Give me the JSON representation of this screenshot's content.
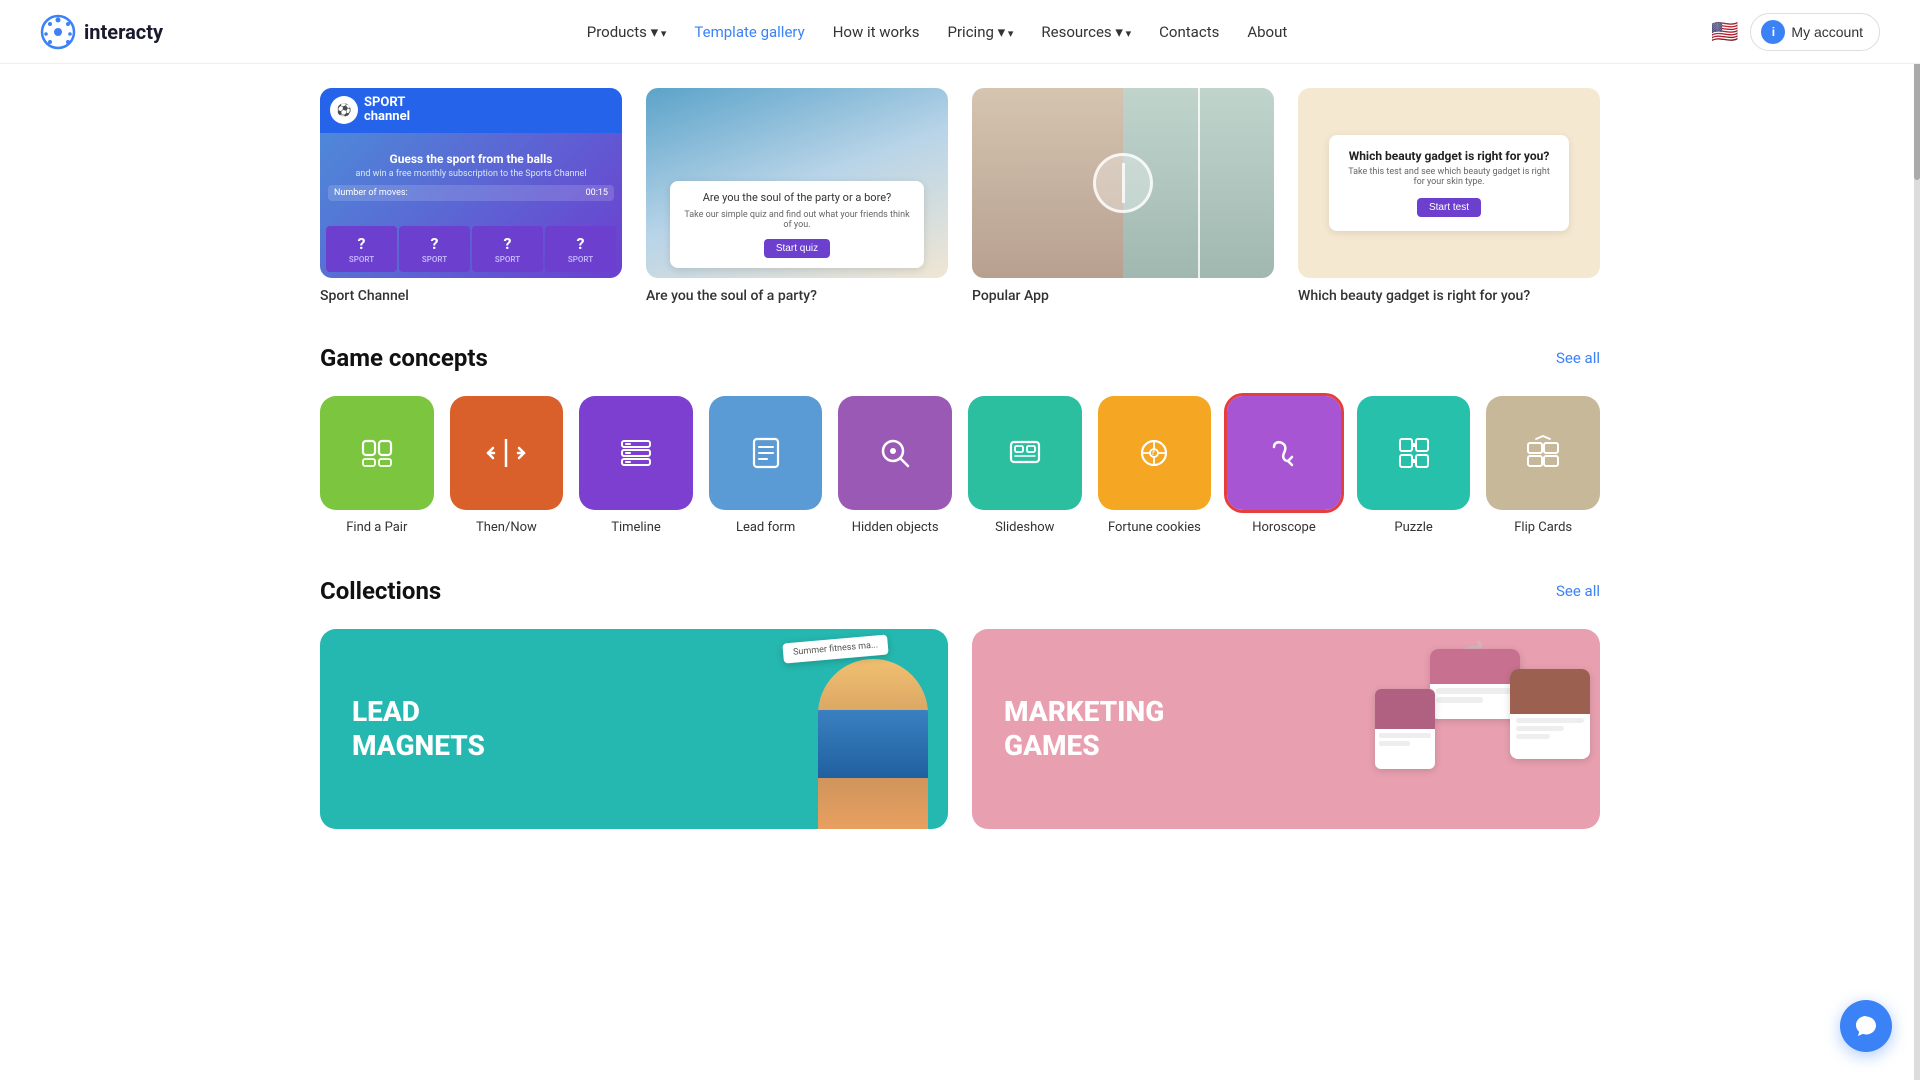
{
  "nav": {
    "logo_text": "interacty",
    "links": [
      {
        "label": "Products",
        "has_arrow": true,
        "active": false
      },
      {
        "label": "Template gallery",
        "has_arrow": false,
        "active": true
      },
      {
        "label": "How it works",
        "has_arrow": false,
        "active": false
      },
      {
        "label": "Pricing",
        "has_arrow": true,
        "active": false
      },
      {
        "label": "Resources",
        "has_arrow": true,
        "active": false
      },
      {
        "label": "Contacts",
        "has_arrow": false,
        "active": false
      },
      {
        "label": "About",
        "has_arrow": false,
        "active": false
      }
    ],
    "flag_emoji": "🇺🇸",
    "account_label": "My account"
  },
  "featured": [
    {
      "label": "Sport Channel"
    },
    {
      "label": "Are you the soul of a party?"
    },
    {
      "label": "Popular App"
    },
    {
      "label": "Which beauty gadget is right for you?"
    }
  ],
  "game_concepts": {
    "title": "Game concepts",
    "see_all": "See all",
    "items": [
      {
        "id": "find-a-pair",
        "label": "Find a Pair",
        "color": "ic-green",
        "icon": "pair"
      },
      {
        "id": "then-now",
        "label": "Then/Now",
        "color": "ic-orange",
        "icon": "arrows"
      },
      {
        "id": "timeline",
        "label": "Timeline",
        "color": "ic-purple",
        "icon": "timeline"
      },
      {
        "id": "lead-form",
        "label": "Lead form",
        "color": "ic-blue",
        "icon": "form"
      },
      {
        "id": "hidden-objects",
        "label": "Hidden objects",
        "color": "ic-lavender",
        "icon": "search"
      },
      {
        "id": "slideshow",
        "label": "Slideshow",
        "color": "ic-teal",
        "icon": "slideshow"
      },
      {
        "id": "fortune-cookies",
        "label": "Fortune cookies",
        "color": "ic-amber",
        "icon": "fortune"
      },
      {
        "id": "horoscope",
        "label": "Horoscope",
        "color": "ic-violet",
        "icon": "horoscope",
        "selected": true
      },
      {
        "id": "puzzle",
        "label": "Puzzle",
        "color": "ic-teal2",
        "icon": "puzzle"
      },
      {
        "id": "flip-cards",
        "label": "Flip Cards",
        "color": "ic-sand",
        "icon": "flipcards"
      }
    ]
  },
  "collections": {
    "title": "Collections",
    "see_all": "See all",
    "items": [
      {
        "id": "lead-magnets",
        "title": "LEAD\nMAGNETS",
        "color": "#25b8b0",
        "deco_text": "Summer fitness ma..."
      },
      {
        "id": "marketing-games",
        "title": "MARKETING\nGAMES",
        "color": "#e8a0b0"
      }
    ]
  },
  "sport_card": {
    "channel_name": "SPORT",
    "sub_line": "channel",
    "guess_text": "Guess the sport from the balls",
    "sub_text": "and win a free monthly subscription to the Sports Channel",
    "moves_label": "Number of moves:",
    "time": "00:15",
    "tiles": [
      "SPORT",
      "SPORT",
      "SPORT",
      "SPORT"
    ]
  },
  "party_card": {
    "question": "Are you the soul of the party or a bore?",
    "sub_text": "Take our simple quiz and find out what your friends think of you.",
    "button": "Start quiz"
  },
  "beauty_card": {
    "title": "Which beauty gadget is right for you?",
    "sub_text": "Take this test and see which beauty gadget is right for your skin type.",
    "button": "Start test"
  },
  "chat_button_label": "Chat"
}
